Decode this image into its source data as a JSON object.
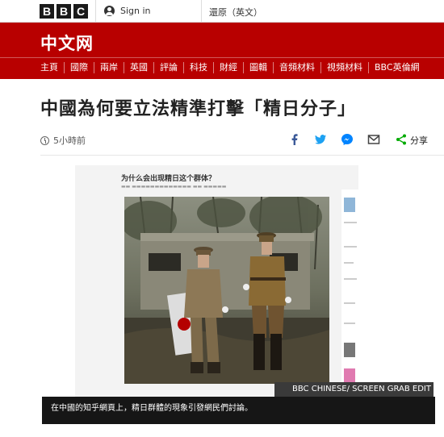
{
  "header": {
    "logo_letters": [
      "B",
      "B",
      "C"
    ],
    "signin_label": "Sign in",
    "language_label": "還原（英文）"
  },
  "site": {
    "name": "中文网"
  },
  "nav": {
    "items": [
      "主頁",
      "國際",
      "兩岸",
      "英國",
      "評論",
      "科技",
      "財經",
      "圖輯",
      "音頻材料",
      "視頻材料",
      "BBC英倫網"
    ]
  },
  "article": {
    "headline": "中國為何要立法精準打擊「精日分子」",
    "timestamp": "5小時前",
    "share_label": "分享"
  },
  "figure": {
    "screenshot_title": "为什么会出现精日这个群体？",
    "credit": "BBC CHINESE/ SCREEN GRAB EDIT",
    "caption": "在中國的知乎網頁上，精日群體的現象引發網民們討論。"
  },
  "colors": {
    "brand_red": "#b80000",
    "facebook": "#3b5998",
    "twitter": "#1da1f2",
    "messenger": "#0084ff"
  },
  "icons": [
    "user-icon",
    "clock-icon",
    "facebook-icon",
    "twitter-icon",
    "messenger-icon",
    "email-icon",
    "share-icon"
  ]
}
